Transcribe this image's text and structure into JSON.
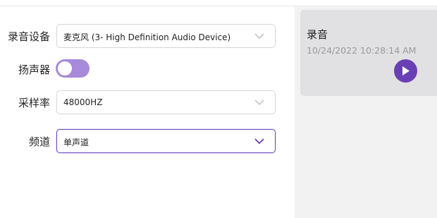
{
  "settings": {
    "recording_device": {
      "label": "录音设备",
      "value": "麦克风 (3- High Definition Audio Device)"
    },
    "speaker": {
      "label": "扬声器",
      "enabled": false
    },
    "sample_rate": {
      "label": "采样率",
      "value": "48000HZ"
    },
    "channel": {
      "label": "频道",
      "value": "单声道"
    }
  },
  "recordings": [
    {
      "title": "录音",
      "timestamp": "10/24/2022 10:28:14 AM"
    }
  ],
  "colors": {
    "accent": "#6a3fb4",
    "toggle_off": "#a78ad9",
    "focus_border": "#6a4bc0",
    "card_bg": "#e1e1e3",
    "panel_bg": "#f2f2f2"
  }
}
